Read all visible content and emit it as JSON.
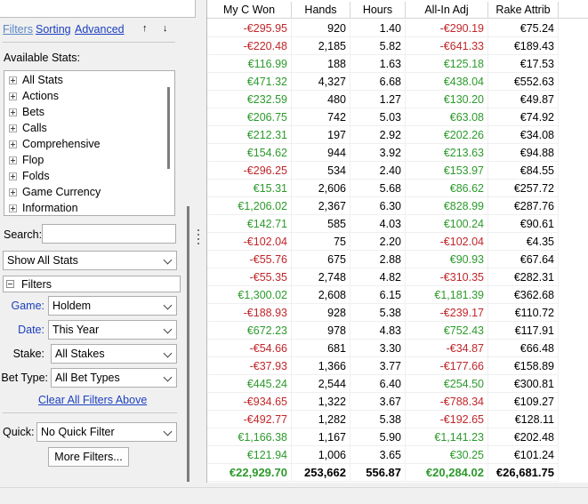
{
  "left_panel": {
    "tabs": {
      "filters": "Filters",
      "sorting": "Sorting",
      "advanced": "Advanced"
    },
    "arrows": {
      "up": "↑",
      "down": "↓"
    },
    "available_stats_label": "Available Stats:",
    "stats_tree": [
      "All Stats",
      "Actions",
      "Bets",
      "Calls",
      "Comprehensive",
      "Flop",
      "Folds",
      "Game Currency",
      "Information"
    ],
    "search_label": "Search:",
    "show_all_stats": "Show All Stats",
    "filters_header": "Filters",
    "game_label": "Game:",
    "game_value": "Holdem",
    "date_label": "Date:",
    "date_value": "This Year",
    "stake_label": "Stake:",
    "stake_value": "All Stakes",
    "bet_type_label": "Bet Type:",
    "bet_type_value": "All Bet Types",
    "clear_filters": "Clear All Filters Above",
    "quick_label": "Quick:",
    "quick_value": "No Quick Filter",
    "more_filters": "More Filters..."
  },
  "grid": {
    "columns": [
      "My C Won",
      "Hands",
      "Hours",
      "All-In Adj",
      "Rake Attrib"
    ],
    "rows": [
      [
        "-€295.95",
        "920",
        "1.40",
        "-€290.19",
        "€75.24"
      ],
      [
        "-€220.48",
        "2,185",
        "5.82",
        "-€641.33",
        "€189.43"
      ],
      [
        "€116.99",
        "188",
        "1.63",
        "€125.18",
        "€17.53"
      ],
      [
        "€471.32",
        "4,327",
        "6.68",
        "€438.04",
        "€552.63"
      ],
      [
        "€232.59",
        "480",
        "1.27",
        "€130.20",
        "€49.87"
      ],
      [
        "€206.75",
        "742",
        "5.03",
        "€63.08",
        "€74.92"
      ],
      [
        "€212.31",
        "197",
        "2.92",
        "€202.26",
        "€34.08"
      ],
      [
        "€154.62",
        "944",
        "3.92",
        "€213.63",
        "€94.88"
      ],
      [
        "-€296.25",
        "534",
        "2.40",
        "€153.97",
        "€84.55"
      ],
      [
        "€15.31",
        "2,606",
        "5.68",
        "€86.62",
        "€257.72"
      ],
      [
        "€1,206.02",
        "2,367",
        "6.30",
        "€828.99",
        "€287.76"
      ],
      [
        "€142.71",
        "585",
        "4.03",
        "€100.24",
        "€90.61"
      ],
      [
        "-€102.04",
        "75",
        "2.20",
        "-€102.04",
        "€4.35"
      ],
      [
        "-€55.76",
        "675",
        "2.88",
        "€90.93",
        "€67.64"
      ],
      [
        "-€55.35",
        "2,748",
        "4.82",
        "-€310.35",
        "€282.31"
      ],
      [
        "€1,300.02",
        "2,608",
        "6.15",
        "€1,181.39",
        "€362.68"
      ],
      [
        "-€188.93",
        "928",
        "5.38",
        "-€239.17",
        "€110.72"
      ],
      [
        "€672.23",
        "978",
        "4.83",
        "€752.43",
        "€117.91"
      ],
      [
        "-€54.66",
        "681",
        "3.30",
        "-€34.87",
        "€66.48"
      ],
      [
        "-€37.93",
        "1,366",
        "3.77",
        "-€177.66",
        "€158.89"
      ],
      [
        "€445.24",
        "2,544",
        "6.40",
        "€254.50",
        "€300.81"
      ],
      [
        "-€934.65",
        "1,322",
        "3.67",
        "-€788.34",
        "€109.27"
      ],
      [
        "-€492.77",
        "1,282",
        "5.38",
        "-€192.65",
        "€128.11"
      ],
      [
        "€1,166.38",
        "1,167",
        "5.90",
        "€1,141.23",
        "€202.48"
      ],
      [
        "€121.94",
        "1,006",
        "3.65",
        "€30.25",
        "€101.24"
      ]
    ],
    "totals": [
      "€22,929.70",
      "253,662",
      "556.87",
      "€20,284.02",
      "€26,681.75"
    ]
  },
  "colors": {
    "positive": "#2c9a2c",
    "negative": "#c0262a",
    "link": "#1a3fbf"
  }
}
